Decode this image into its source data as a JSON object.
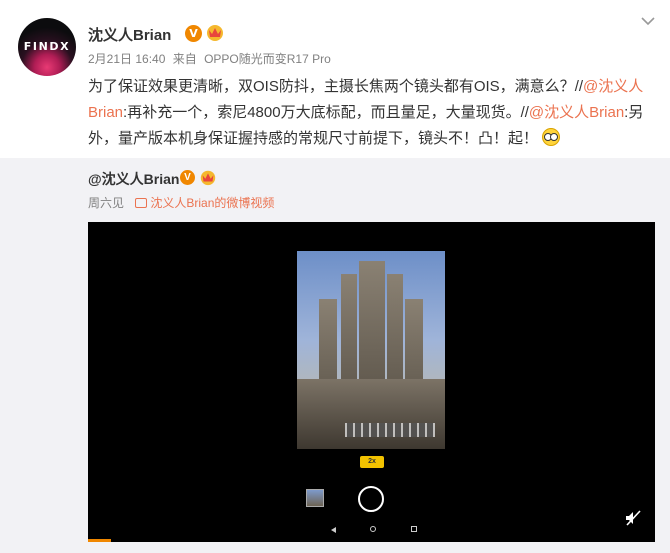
{
  "post": {
    "avatar_text": "FINDX",
    "username": "沈义人Brian",
    "verified_badge": "V",
    "timestamp": "2月21日 16:40",
    "source_prefix": "来自",
    "source_device": "OPPO随光而变R17 Pro",
    "content": {
      "part1": "为了保证效果更清晰，双OIS防抖，主摄长焦两个镜头都有OIS，满意么？",
      "sep1": "//",
      "mention1": "@沈义人Brian",
      "part2": ":再补充一个，索尼4800万大底标配，而且量足，大量现货。",
      "sep2": "//",
      "mention2": "@沈义人Brian",
      "part3": ":另外，量产版本机身保证握持感的常规尺寸前提下，镜头不！凸！起！"
    }
  },
  "repost": {
    "username": "@沈义人Brian",
    "verified_badge": "V",
    "time": "周六见",
    "video_link": "沈义人Brian的微博视频"
  },
  "player": {
    "zoom_label": "2x",
    "progress_fraction": 0.04
  },
  "colors": {
    "accent": "#eb7350",
    "badge": "#f08700",
    "repost_bg": "#f2f2f5"
  }
}
